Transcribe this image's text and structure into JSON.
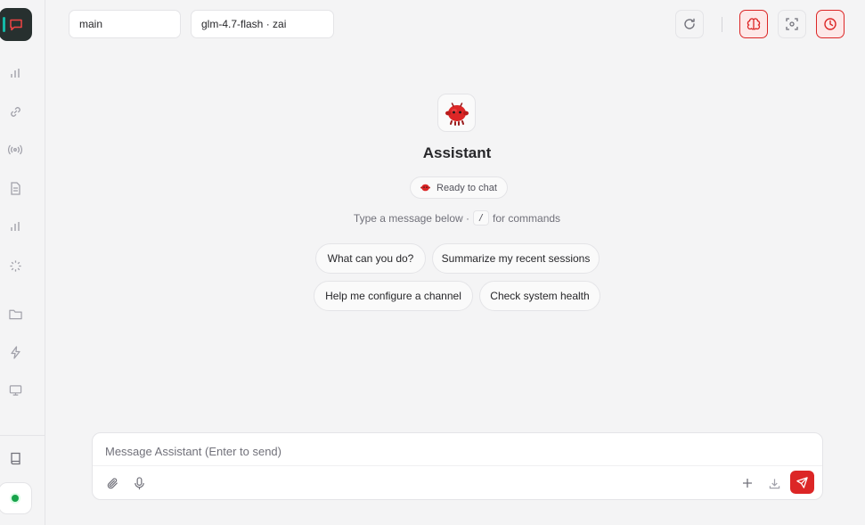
{
  "header": {
    "agent_select": "main",
    "model_select": "glm-4.7-flash · zai"
  },
  "sidebar": {
    "items": [
      "chat-icon",
      "bar-chart-icon",
      "link-icon",
      "broadcast-icon",
      "document-icon",
      "analytics-icon",
      "loader-icon",
      "folder-icon",
      "lightning-icon",
      "monitor-icon",
      "book-icon"
    ],
    "status": "online"
  },
  "welcome": {
    "title": "Assistant",
    "status_badge": "Ready to chat",
    "hint_prefix": "Type a message below ·",
    "hint_key": "/",
    "hint_suffix": "for commands"
  },
  "suggestions": [
    "What can you do?",
    "Summarize my recent sessions",
    "Help me configure a channel",
    "Check system health"
  ],
  "composer": {
    "placeholder": "Message Assistant (Enter to send)",
    "value": ""
  },
  "colors": {
    "accent": "#dc2626",
    "active_bar": "#14b8a6",
    "status_online": "#16a34a"
  }
}
